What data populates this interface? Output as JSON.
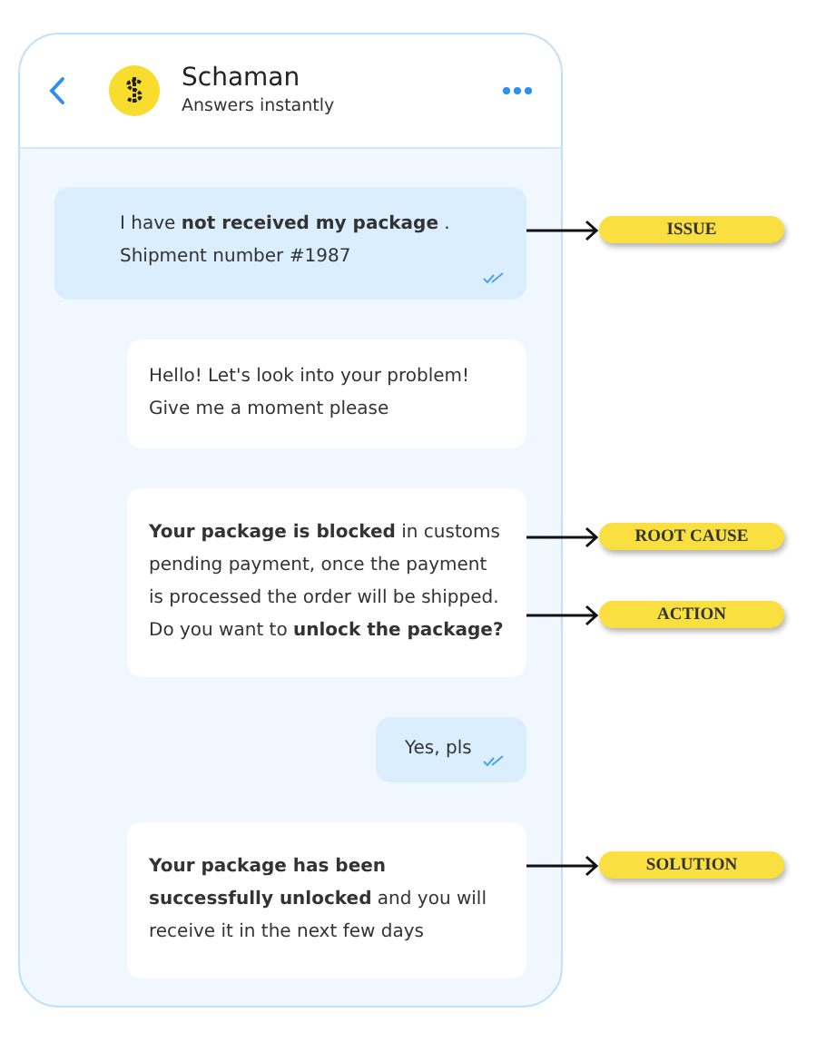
{
  "header": {
    "title": "Schaman",
    "subtitle": "Answers instantly"
  },
  "messages": [
    {
      "kind": "sent",
      "text": "I have **not received my package** .\nShipment number #1987",
      "read": true,
      "annotations": [
        {
          "label": "ISSUE"
        }
      ]
    },
    {
      "kind": "received",
      "text": "Hello! Let's look into your problem!\nGive me a moment please"
    },
    {
      "kind": "received",
      "text": "**Your package is blocked** in customs pending payment, once the payment is processed the order will be shipped. Do you want to **unlock the package?**",
      "annotations": [
        {
          "label": "ROOT CAUSE"
        },
        {
          "label": "ACTION"
        }
      ]
    },
    {
      "kind": "sent",
      "text": "Yes, pls",
      "read": true
    },
    {
      "kind": "received",
      "text": "**Your package has been successfully unlocked** and you will receive it in the next few days",
      "annotations": [
        {
          "label": "SOLUTION"
        }
      ]
    }
  ]
}
